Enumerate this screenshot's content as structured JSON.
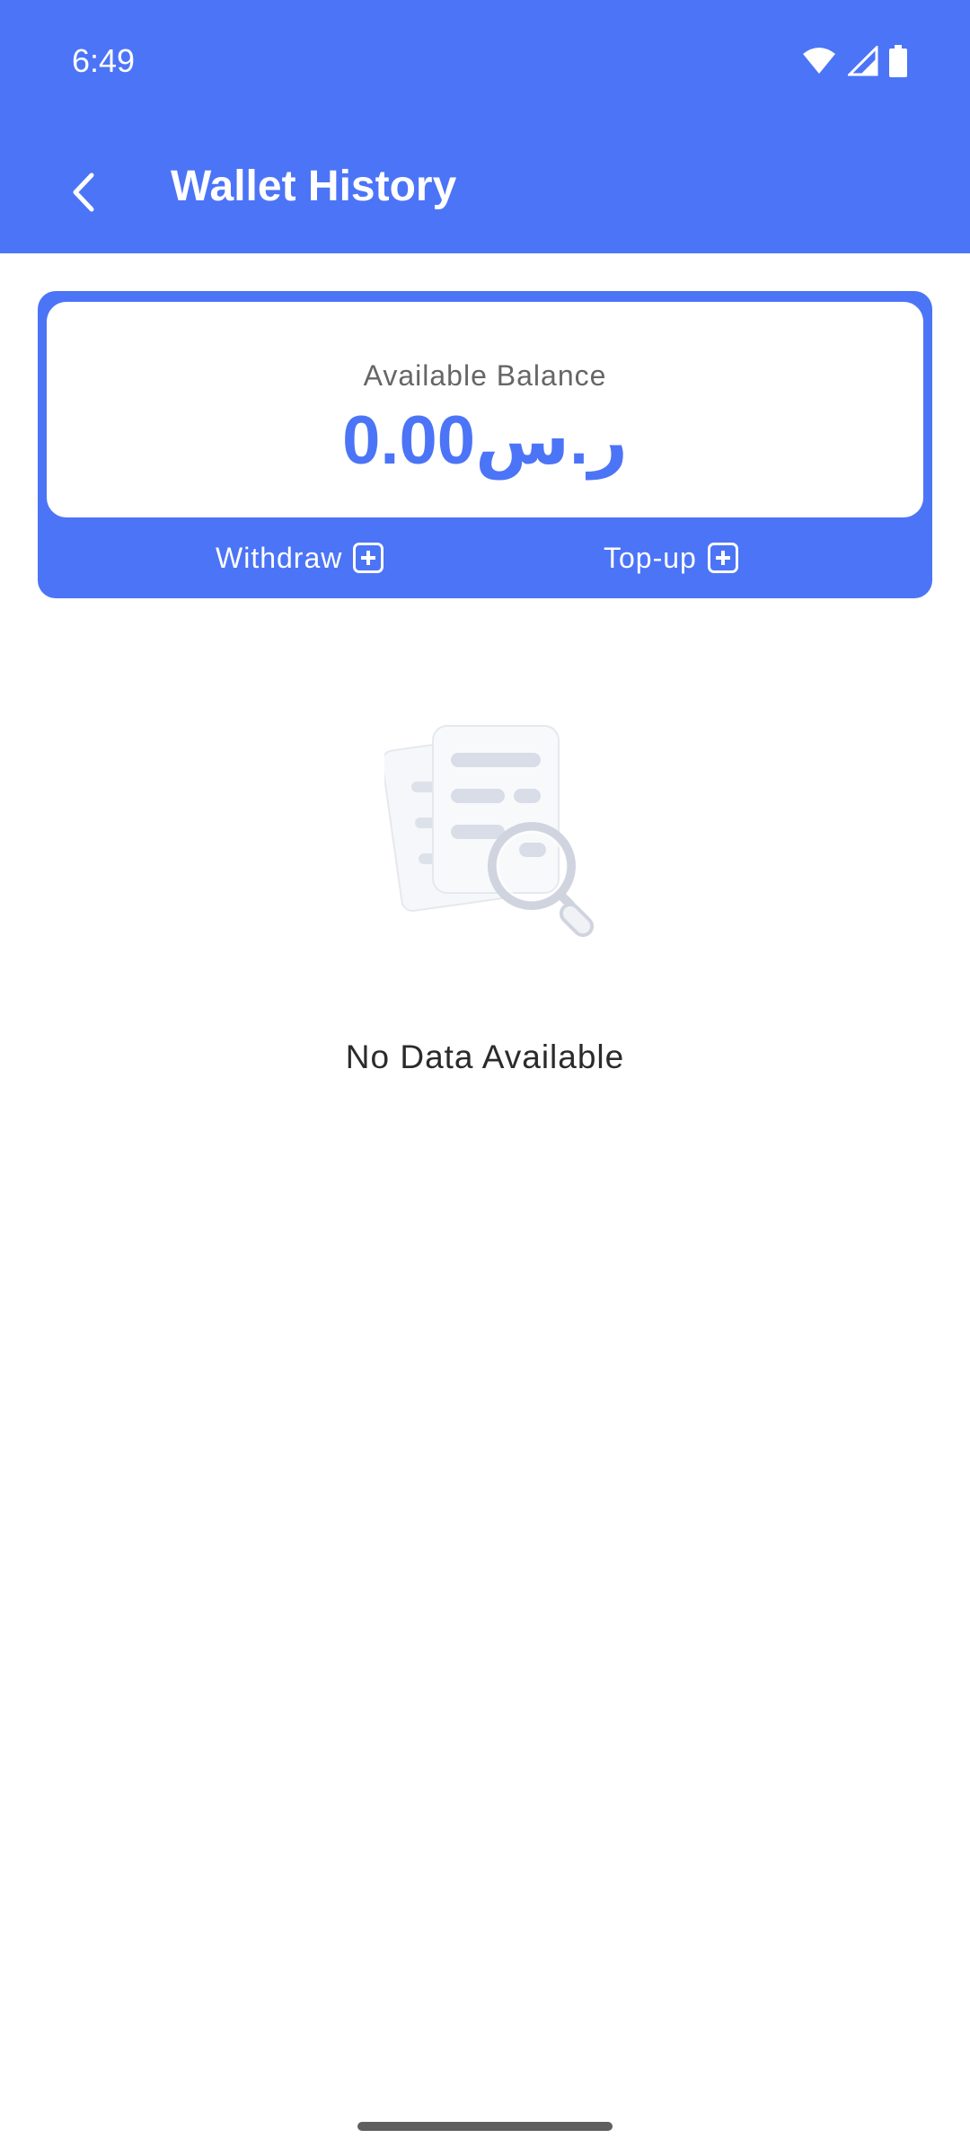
{
  "status_bar": {
    "time": "6:49",
    "icons": [
      "wifi-icon",
      "signal-icon",
      "battery-icon"
    ]
  },
  "app_bar": {
    "title": "Wallet History",
    "back_icon": "chevron-left-icon"
  },
  "balance": {
    "label": "Available Balance",
    "value": "0.00ر.س"
  },
  "actions": {
    "withdraw_label": "Withdraw",
    "topup_label": "Top-up"
  },
  "empty_state": {
    "message": "No Data Available",
    "illustration": "documents-search-icon"
  },
  "colors": {
    "primary": "#4c74f6",
    "background": "#ffffff",
    "text_dark": "#2b2b2b",
    "text_muted": "#666666"
  }
}
